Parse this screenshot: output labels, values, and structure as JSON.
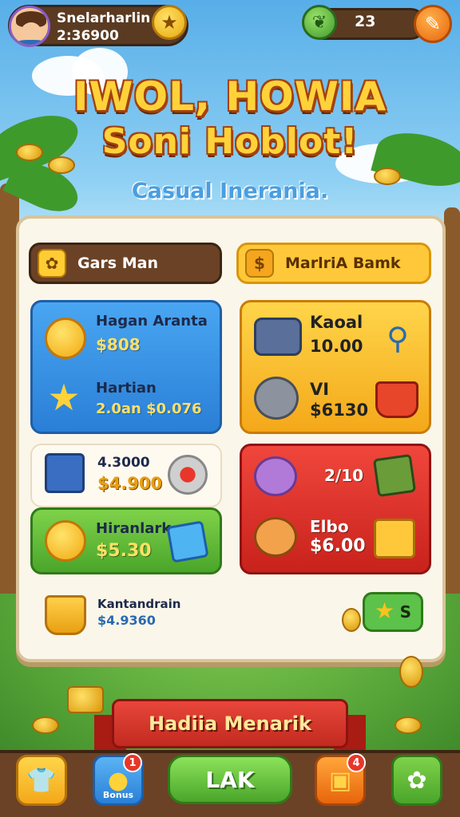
{
  "player": {
    "name": "Snelarharlin",
    "score": "2:36900"
  },
  "top_right": {
    "count": "23"
  },
  "title": {
    "line1": "IWOL, HOWIA",
    "line2": "Soni Hoblot!",
    "subtitle": "Casual Inerania."
  },
  "tabs": {
    "games": "Gars Man",
    "bank": "MarlriA Bamk"
  },
  "cards": {
    "blue": {
      "item1_name": "Hagan Aranta",
      "item1_price": "$808",
      "item2_name": "Hartian",
      "item2_price": "2.0an $0.076"
    },
    "gold": {
      "item1_name": "Kaoal",
      "item1_price": "10.00",
      "item2_name": "VI",
      "item2_price": "$6130"
    },
    "white": {
      "name": "4.3000",
      "price": "$4.900"
    },
    "green": {
      "name": "Hiranlark",
      "price": "$5.30"
    },
    "red": {
      "item1_name": "2/10",
      "item2_name": "Elbo",
      "item2_price": "$6.00"
    }
  },
  "bottom_item": {
    "name": "Kantandrain",
    "price": "$4.9360"
  },
  "share_button": {
    "label": "S"
  },
  "ribbon": {
    "text": "Hadiia Menarik"
  },
  "bottom_nav": {
    "main_label": "LAK",
    "bonus_label": "Bonus",
    "bonus_badge": "1",
    "box_badge": "4"
  }
}
